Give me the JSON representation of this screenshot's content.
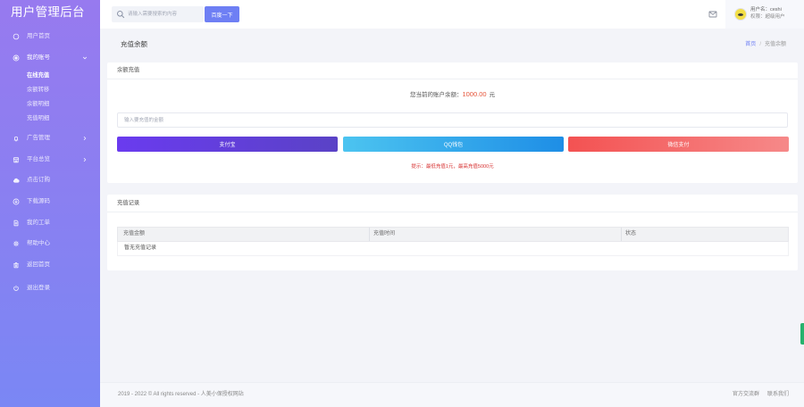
{
  "app": {
    "title": "用户管理后台"
  },
  "colors": {
    "sidebar_top": "#977aef",
    "sidebar_bottom": "#7a87f4",
    "accent": "#6e7ff4",
    "alipay": "#6a3bef",
    "qq_wallet": "#1e8ee6",
    "wechat": "#f35252",
    "balance_value": "#e5553a",
    "hint": "#d62f2f",
    "side_tab": "#27b26d"
  },
  "search": {
    "placeholder": "请输入需要搜索的内容",
    "button_label": "百度一下"
  },
  "user": {
    "name_line": "用户名：ceshi",
    "role_line": "权限：超级用户"
  },
  "sidebar": {
    "items": [
      {
        "label": "用户首页",
        "icon": "home-icon"
      },
      {
        "label": "我的账号",
        "icon": "account-icon",
        "expanded": true,
        "children": [
          {
            "label": "在线充值",
            "active": true
          },
          {
            "label": "余额转移"
          },
          {
            "label": "余额明细"
          },
          {
            "label": "充值明细"
          }
        ]
      },
      {
        "label": "广告管理",
        "icon": "bell-icon"
      },
      {
        "label": "平台总览",
        "icon": "store-icon"
      },
      {
        "label": "点击订购",
        "icon": "cloud-icon"
      },
      {
        "label": "下载源码",
        "icon": "download-icon"
      },
      {
        "label": "我的工单",
        "icon": "document-icon"
      },
      {
        "label": "帮助中心",
        "icon": "help-icon"
      },
      {
        "label": "返回首页",
        "icon": "basket-icon"
      },
      {
        "label": "退出登录",
        "icon": "power-icon"
      }
    ]
  },
  "page": {
    "title": "充值余额",
    "breadcrumb": [
      {
        "label": "首页"
      },
      {
        "label": "充值余额"
      }
    ],
    "breadcrumb_separator": "/"
  },
  "recharge_card": {
    "title": "余额充值",
    "balance_label": "您当前的账户余额：",
    "balance_value": "1000.00",
    "balance_unit": "元",
    "amount_placeholder": "输入要充值的金额",
    "pay_buttons": [
      {
        "label": "支付宝"
      },
      {
        "label": "QQ钱包"
      },
      {
        "label": "微信支付"
      }
    ],
    "hint": "提示：最低充值1元，最高充值5000元"
  },
  "records_card": {
    "title": "充值记录",
    "columns": [
      "充值金额",
      "充值时间",
      "状态"
    ],
    "empty_text": "暂无充值记录"
  },
  "footer": {
    "copyright": "2019 - 2022 © All rights reserved - 人美小保授权网站",
    "links": [
      "官方交流群",
      "联系我们"
    ]
  }
}
